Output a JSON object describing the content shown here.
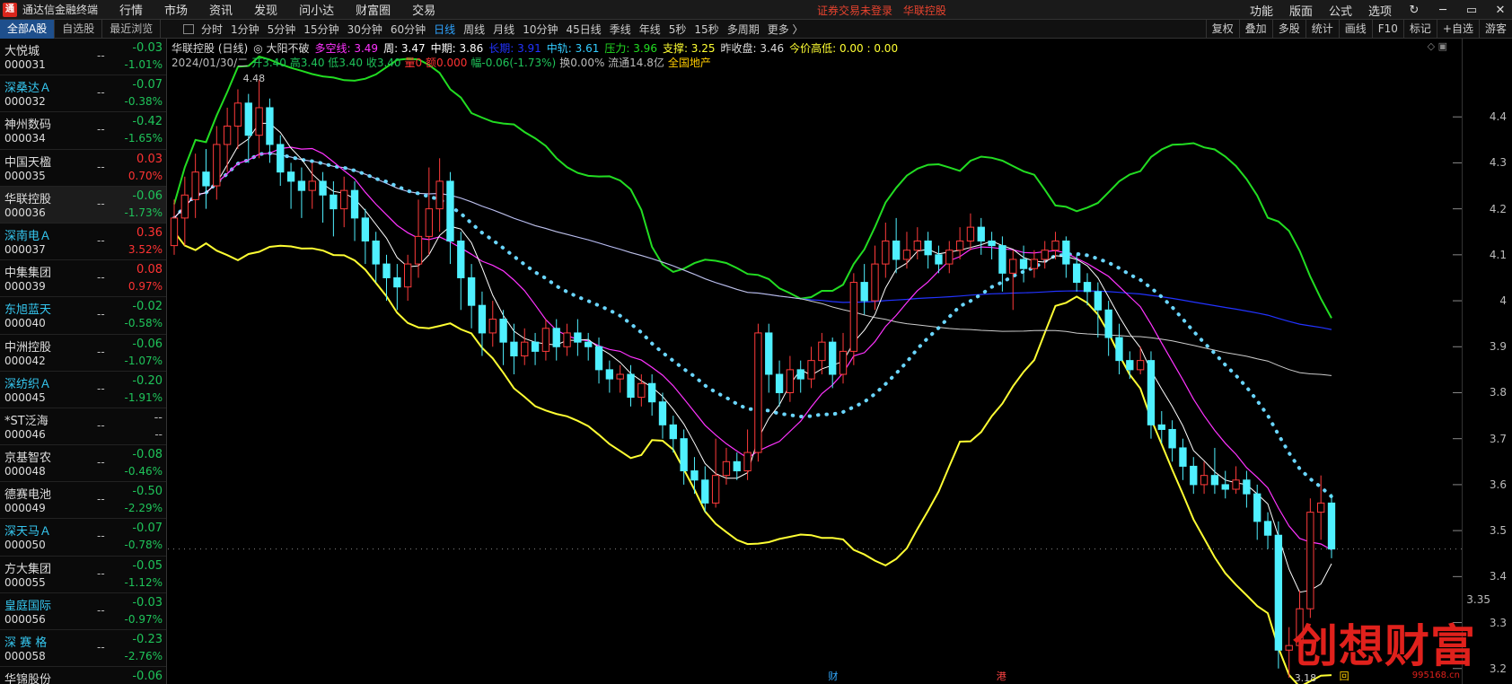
{
  "app": {
    "title": "通达信金融终端",
    "logo_icon": "tdx-logo-icon"
  },
  "menu": [
    "行情",
    "市场",
    "资讯",
    "发现",
    "问小达",
    "财富圈",
    "交易"
  ],
  "notice": {
    "text": "证券交易未登录",
    "stock": "华联控股"
  },
  "top_right": [
    "功能",
    "版面",
    "公式",
    "选项"
  ],
  "window_controls": [
    "refresh-icon",
    "minimize-icon",
    "restore-icon",
    "close-icon"
  ],
  "stock_tabs": [
    "全部A股",
    "自选股",
    "最近浏览"
  ],
  "period_tabs": [
    "分时",
    "1分钟",
    "5分钟",
    "15分钟",
    "30分钟",
    "60分钟",
    "日线",
    "周线",
    "月线",
    "10分钟",
    "45日线",
    "季线",
    "年线",
    "5秒",
    "15秒",
    "多周期",
    "更多 〉"
  ],
  "active_period": "日线",
  "tool_tabs": [
    "复权",
    "叠加",
    "多股",
    "统计",
    "画线",
    "F10",
    "标记",
    "+自选"
  ],
  "extra_tool": "游客",
  "stocks": [
    {
      "name": "大悦城",
      "code": "000031",
      "chg": "-0.03",
      "pct": "-1.01%",
      "dir": "down",
      "blue": false
    },
    {
      "name": "深桑达Ａ",
      "code": "000032",
      "chg": "-0.07",
      "pct": "-0.38%",
      "dir": "down",
      "blue": true
    },
    {
      "name": "神州数码",
      "code": "000034",
      "chg": "-0.42",
      "pct": "-1.65%",
      "dir": "down",
      "blue": false
    },
    {
      "name": "中国天楹",
      "code": "000035",
      "chg": "0.03",
      "pct": "0.70%",
      "dir": "up",
      "blue": false
    },
    {
      "name": "华联控股",
      "code": "000036",
      "chg": "-0.06",
      "pct": "-1.73%",
      "dir": "down",
      "blue": false
    },
    {
      "name": "深南电Ａ",
      "code": "000037",
      "chg": "0.36",
      "pct": "3.52%",
      "dir": "up",
      "blue": true
    },
    {
      "name": "中集集团",
      "code": "000039",
      "chg": "0.08",
      "pct": "0.97%",
      "dir": "up",
      "blue": false
    },
    {
      "name": "东旭蓝天",
      "code": "000040",
      "chg": "-0.02",
      "pct": "-0.58%",
      "dir": "down",
      "blue": true
    },
    {
      "name": "中洲控股",
      "code": "000042",
      "chg": "-0.06",
      "pct": "-1.07%",
      "dir": "down",
      "blue": false
    },
    {
      "name": "深纺织Ａ",
      "code": "000045",
      "chg": "-0.20",
      "pct": "-1.91%",
      "dir": "down",
      "blue": true
    },
    {
      "name": "*ST泛海",
      "code": "000046",
      "chg": "--",
      "pct": "--",
      "dir": "flat",
      "blue": false
    },
    {
      "name": "京基智农",
      "code": "000048",
      "chg": "-0.08",
      "pct": "-0.46%",
      "dir": "down",
      "blue": false
    },
    {
      "name": "德赛电池",
      "code": "000049",
      "chg": "-0.50",
      "pct": "-2.29%",
      "dir": "down",
      "blue": false
    },
    {
      "name": "深天马Ａ",
      "code": "000050",
      "chg": "-0.07",
      "pct": "-0.78%",
      "dir": "down",
      "blue": true
    },
    {
      "name": "方大集团",
      "code": "000055",
      "chg": "-0.05",
      "pct": "-1.12%",
      "dir": "down",
      "blue": false
    },
    {
      "name": "皇庭国际",
      "code": "000056",
      "chg": "-0.03",
      "pct": "-0.97%",
      "dir": "down",
      "blue": true
    },
    {
      "name": "深 赛 格",
      "code": "000058",
      "chg": "-0.23",
      "pct": "-2.76%",
      "dir": "down",
      "blue": true
    },
    {
      "name": "华锦股份",
      "code": "",
      "chg": "-0.06",
      "pct": "",
      "dir": "down",
      "blue": false
    }
  ],
  "selected_stock_index": 4,
  "info_line1": [
    {
      "text": "华联控股 (日线)",
      "color": "#dddddd"
    },
    {
      "text": "◎ 大阳不破",
      "color": "#dddddd"
    },
    {
      "text": "多空线: 3.49",
      "color": "#ff33ff"
    },
    {
      "text": "周: 3.47",
      "color": "#ffffff"
    },
    {
      "text": "中期: 3.86",
      "color": "#ffffff"
    },
    {
      "text": "长期: 3.91",
      "color": "#2233ff"
    },
    {
      "text": "中轨: 3.61",
      "color": "#33ccff"
    },
    {
      "text": "压力: 3.96",
      "color": "#22dd22"
    },
    {
      "text": "支撑: 3.25",
      "color": "#ffff33"
    },
    {
      "text": "昨收盘: 3.46",
      "color": "#dddddd"
    },
    {
      "text": "今价高低: 0.00 : 0.00",
      "color": "#ffff33"
    }
  ],
  "info_line2": [
    {
      "text": "2024/01/30/二",
      "color": "#bbbbbb"
    },
    {
      "text": "开3.40 高3.40 低3.40 收3.40",
      "color": "#1fc45a"
    },
    {
      "text": "量0 额0.000",
      "color": "#ff3333"
    },
    {
      "text": "幅-0.06(-1.73%)",
      "color": "#1fc45a"
    },
    {
      "text": "换0.00% 流通14.8亿",
      "color": "#bbbbbb"
    },
    {
      "text": "全国地产",
      "color": "#ffcc00"
    }
  ],
  "chart_data": {
    "type": "candlestick",
    "ylim": [
      3.18,
      4.5
    ],
    "yticks": [
      4.4,
      4.3,
      4.2,
      4.1,
      4.0,
      3.9,
      3.8,
      3.7,
      3.6,
      3.5,
      3.4,
      3.3,
      3.2
    ],
    "max_label": "4.48",
    "min_label": "3.18",
    "last_price_line": 3.46,
    "cursor_price": "3.35",
    "colors": {
      "up": "#ff3b3b",
      "down": "#4ff0ff",
      "ma_short": "#ffffff",
      "ma_mid": "#ff33ff",
      "ma_long": "#2233ff",
      "ma_xlong": "#cccccc",
      "upper": "#22dd22",
      "lower": "#ffff33",
      "dotted": "#6ad6ff"
    },
    "candles": [
      [
        4.12,
        4.18,
        4.1,
        4.22
      ],
      [
        4.18,
        4.23,
        4.12,
        4.27
      ],
      [
        4.22,
        4.28,
        4.18,
        4.32
      ],
      [
        4.28,
        4.25,
        4.2,
        4.33
      ],
      [
        4.25,
        4.34,
        4.22,
        4.38
      ],
      [
        4.34,
        4.38,
        4.28,
        4.42
      ],
      [
        4.38,
        4.43,
        4.33,
        4.46
      ],
      [
        4.43,
        4.36,
        4.3,
        4.45
      ],
      [
        4.36,
        4.42,
        4.31,
        4.48
      ],
      [
        4.42,
        4.34,
        4.3,
        4.44
      ],
      [
        4.34,
        4.28,
        4.25,
        4.36
      ],
      [
        4.28,
        4.26,
        4.2,
        4.3
      ],
      [
        4.26,
        4.24,
        4.18,
        4.29
      ],
      [
        4.24,
        4.26,
        4.2,
        4.3
      ],
      [
        4.26,
        4.23,
        4.17,
        4.28
      ],
      [
        4.23,
        4.2,
        4.14,
        4.26
      ],
      [
        4.2,
        4.24,
        4.16,
        4.27
      ],
      [
        4.24,
        4.18,
        4.13,
        4.26
      ],
      [
        4.18,
        4.13,
        4.08,
        4.2
      ],
      [
        4.13,
        4.08,
        4.04,
        4.15
      ],
      [
        4.08,
        4.05,
        4.0,
        4.1
      ],
      [
        4.05,
        4.03,
        3.98,
        4.08
      ],
      [
        4.03,
        4.08,
        4.0,
        4.1
      ],
      [
        4.08,
        4.14,
        4.05,
        4.22
      ],
      [
        4.14,
        4.2,
        4.1,
        4.29
      ],
      [
        4.2,
        4.26,
        4.15,
        4.31
      ],
      [
        4.26,
        4.13,
        4.08,
        4.28
      ],
      [
        4.13,
        4.05,
        3.98,
        4.15
      ],
      [
        4.05,
        3.99,
        3.94,
        4.08
      ],
      [
        3.99,
        3.93,
        3.88,
        4.02
      ],
      [
        3.93,
        3.96,
        3.9,
        4.0
      ],
      [
        3.96,
        3.91,
        3.86,
        3.98
      ],
      [
        3.91,
        3.88,
        3.84,
        3.95
      ],
      [
        3.88,
        3.91,
        3.86,
        3.94
      ],
      [
        3.91,
        3.89,
        3.86,
        3.93
      ],
      [
        3.89,
        3.94,
        3.87,
        3.96
      ],
      [
        3.94,
        3.9,
        3.87,
        3.96
      ],
      [
        3.9,
        3.93,
        3.88,
        3.95
      ],
      [
        3.93,
        3.91,
        3.88,
        3.96
      ],
      [
        3.91,
        3.9,
        3.87,
        3.93
      ],
      [
        3.9,
        3.85,
        3.82,
        3.92
      ],
      [
        3.85,
        3.83,
        3.8,
        3.87
      ],
      [
        3.83,
        3.84,
        3.8,
        3.86
      ],
      [
        3.84,
        3.79,
        3.77,
        3.86
      ],
      [
        3.79,
        3.82,
        3.77,
        3.84
      ],
      [
        3.82,
        3.78,
        3.75,
        3.84
      ],
      [
        3.78,
        3.73,
        3.7,
        3.8
      ],
      [
        3.73,
        3.7,
        3.67,
        3.75
      ],
      [
        3.7,
        3.63,
        3.6,
        3.72
      ],
      [
        3.63,
        3.61,
        3.58,
        3.66
      ],
      [
        3.61,
        3.56,
        3.54,
        3.64
      ],
      [
        3.56,
        3.62,
        3.55,
        3.7
      ],
      [
        3.62,
        3.65,
        3.6,
        3.68
      ],
      [
        3.65,
        3.63,
        3.61,
        3.67
      ],
      [
        3.63,
        3.67,
        3.61,
        3.72
      ],
      [
        3.67,
        3.93,
        3.65,
        3.95
      ],
      [
        3.93,
        3.84,
        3.8,
        3.95
      ],
      [
        3.84,
        3.8,
        3.77,
        3.87
      ],
      [
        3.8,
        3.85,
        3.78,
        3.88
      ],
      [
        3.85,
        3.83,
        3.8,
        3.87
      ],
      [
        3.83,
        3.87,
        3.81,
        3.9
      ],
      [
        3.87,
        3.91,
        3.84,
        3.93
      ],
      [
        3.91,
        3.84,
        3.81,
        3.92
      ],
      [
        3.84,
        3.89,
        3.82,
        3.93
      ],
      [
        3.89,
        4.04,
        3.86,
        4.06
      ],
      [
        4.04,
        4.0,
        3.97,
        4.08
      ],
      [
        4.0,
        4.08,
        3.98,
        4.12
      ],
      [
        4.08,
        4.13,
        4.05,
        4.17
      ],
      [
        4.13,
        4.09,
        4.06,
        4.18
      ],
      [
        4.09,
        4.11,
        4.07,
        4.15
      ],
      [
        4.11,
        4.13,
        4.09,
        4.16
      ],
      [
        4.13,
        4.1,
        4.07,
        4.15
      ],
      [
        4.1,
        4.08,
        4.06,
        4.12
      ],
      [
        4.08,
        4.11,
        4.06,
        4.13
      ],
      [
        4.11,
        4.13,
        4.09,
        4.16
      ],
      [
        4.13,
        4.16,
        4.11,
        4.19
      ],
      [
        4.16,
        4.13,
        4.1,
        4.18
      ],
      [
        4.13,
        4.12,
        4.09,
        4.15
      ],
      [
        4.12,
        4.06,
        4.02,
        4.14
      ],
      [
        4.06,
        4.09,
        3.98,
        4.11
      ],
      [
        4.09,
        4.07,
        4.04,
        4.12
      ],
      [
        4.07,
        4.09,
        4.05,
        4.11
      ],
      [
        4.09,
        4.11,
        4.07,
        4.13
      ],
      [
        4.11,
        4.13,
        4.09,
        4.15
      ],
      [
        4.13,
        4.08,
        4.05,
        4.14
      ],
      [
        4.08,
        4.04,
        4.02,
        4.1
      ],
      [
        4.04,
        4.02,
        3.99,
        4.06
      ],
      [
        4.02,
        3.98,
        3.92,
        4.04
      ],
      [
        3.98,
        3.92,
        3.88,
        4.0
      ],
      [
        3.92,
        3.87,
        3.84,
        3.95
      ],
      [
        3.87,
        3.85,
        3.83,
        3.89
      ],
      [
        3.85,
        3.87,
        3.84,
        3.9
      ],
      [
        3.87,
        3.73,
        3.7,
        3.89
      ],
      [
        3.73,
        3.72,
        3.69,
        3.76
      ],
      [
        3.72,
        3.68,
        3.65,
        3.74
      ],
      [
        3.68,
        3.64,
        3.61,
        3.7
      ],
      [
        3.64,
        3.6,
        3.58,
        3.66
      ],
      [
        3.6,
        3.62,
        3.58,
        3.65
      ],
      [
        3.62,
        3.6,
        3.58,
        3.68
      ],
      [
        3.6,
        3.59,
        3.57,
        3.63
      ],
      [
        3.59,
        3.61,
        3.58,
        3.64
      ],
      [
        3.61,
        3.58,
        3.55,
        3.63
      ],
      [
        3.58,
        3.52,
        3.48,
        3.6
      ],
      [
        3.52,
        3.49,
        3.46,
        3.54
      ],
      [
        3.49,
        3.24,
        3.2,
        3.52
      ],
      [
        3.24,
        3.25,
        3.18,
        3.29
      ],
      [
        3.25,
        3.33,
        3.23,
        3.37
      ],
      [
        3.33,
        3.54,
        3.31,
        3.57
      ],
      [
        3.54,
        3.56,
        3.48,
        3.62
      ],
      [
        3.56,
        3.46,
        3.44,
        3.58
      ]
    ]
  },
  "bottom_markers": [
    "财",
    "港",
    "回"
  ],
  "watermark": {
    "text": "创想财富",
    "url": "995168.cn"
  }
}
